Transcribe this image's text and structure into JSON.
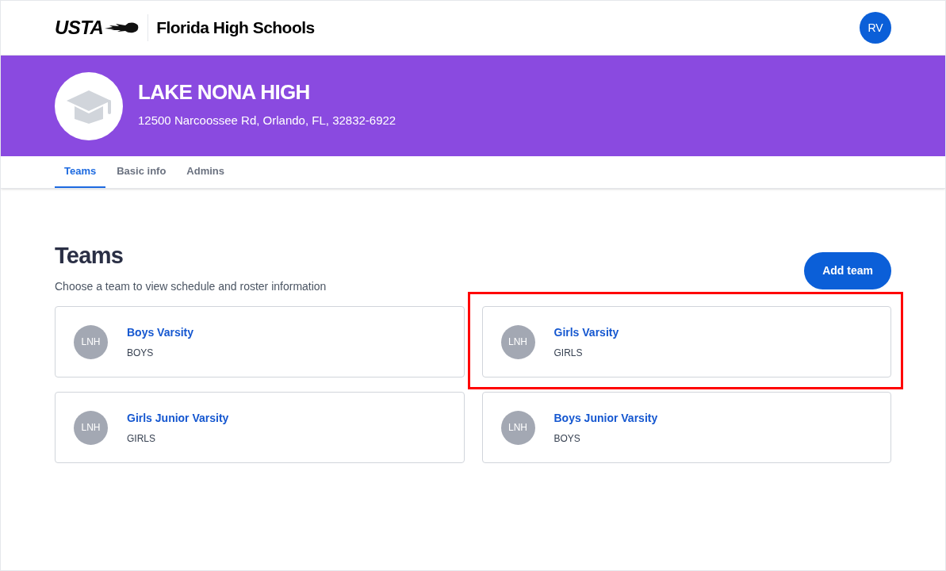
{
  "header": {
    "logo_text": "USTA",
    "title": "Florida High Schools",
    "avatar": "RV"
  },
  "banner": {
    "name": "LAKE NONA HIGH",
    "address": "12500 Narcoossee Rd, Orlando, FL, 32832-6922"
  },
  "tabs": [
    {
      "label": "Teams",
      "selected": true
    },
    {
      "label": "Basic info",
      "selected": false
    },
    {
      "label": "Admins",
      "selected": false
    }
  ],
  "section": {
    "title": "Teams",
    "subtitle": "Choose a team to view schedule and roster information",
    "add_button": "Add team"
  },
  "teams": [
    {
      "initials": "LNH",
      "name": "Boys Varsity",
      "gender": "BOYS",
      "highlighted": false
    },
    {
      "initials": "LNH",
      "name": "Girls Varsity",
      "gender": "GIRLS",
      "highlighted": true
    },
    {
      "initials": "LNH",
      "name": "Girls Junior Varsity",
      "gender": "GIRLS",
      "highlighted": false
    },
    {
      "initials": "LNH",
      "name": "Boys Junior Varsity",
      "gender": "BOYS",
      "highlighted": false
    }
  ]
}
